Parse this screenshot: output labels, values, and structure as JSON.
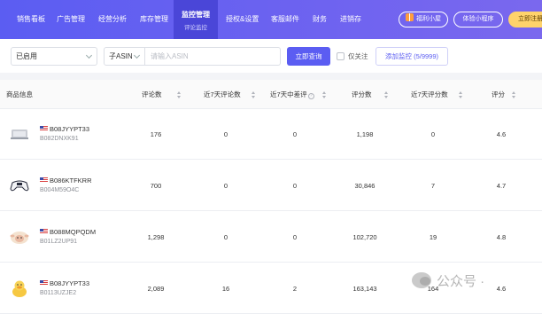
{
  "nav": {
    "items": [
      {
        "label": "销售看板"
      },
      {
        "label": "广告管理"
      },
      {
        "label": "经营分析"
      },
      {
        "label": "库存管理"
      },
      {
        "label": "监控管理",
        "sub": "评论监控",
        "active": true
      },
      {
        "label": "授权&设置"
      },
      {
        "label": "客服邮件"
      },
      {
        "label": "财务"
      },
      {
        "label": "进销存"
      }
    ],
    "welfare_label": "福利小屋",
    "miniapp_label": "体验小程序",
    "register_label": "立即注册"
  },
  "filters": {
    "status_value": "已启用",
    "asin_type_value": "子ASIN",
    "search_placeholder": "请输入ASIN",
    "query_label": "立即查询",
    "only_follow_label": "仅关注",
    "add_monitor_label": "添加监控 (5/9999)"
  },
  "table": {
    "columns": [
      "商品信息",
      "评论数",
      "近7天评论数",
      "近7天中差评",
      "评分数",
      "近7天评分数",
      "评分"
    ],
    "rows": [
      {
        "asin": "B08JYYPT33",
        "parent": "B082DNXK91",
        "thumb": "device-icon",
        "reviews": "176",
        "reviews_7d": "0",
        "neg_7d": "0",
        "ratings": "1,198",
        "ratings_7d": "0",
        "score": "4.6"
      },
      {
        "asin": "B086KTFKRR",
        "parent": "B004M59O4C",
        "thumb": "gamepad-icon",
        "reviews": "700",
        "reviews_7d": "0",
        "neg_7d": "0",
        "ratings": "30,846",
        "ratings_7d": "7",
        "score": "4.7"
      },
      {
        "asin": "B088MQPQDM",
        "parent": "B01LZ2UP91",
        "thumb": "plush-sheep-icon",
        "reviews": "1,298",
        "reviews_7d": "0",
        "neg_7d": "0",
        "ratings": "102,720",
        "ratings_7d": "19",
        "score": "4.8"
      },
      {
        "asin": "B08JYYPT33",
        "parent": "B0113UZJE2",
        "thumb": "plush-duck-icon",
        "reviews": "2,089",
        "reviews_7d": "16",
        "neg_7d": "2",
        "ratings": "163,143",
        "ratings_7d": "164",
        "score": "4.6"
      }
    ]
  },
  "watermark": "公众号 · "
}
